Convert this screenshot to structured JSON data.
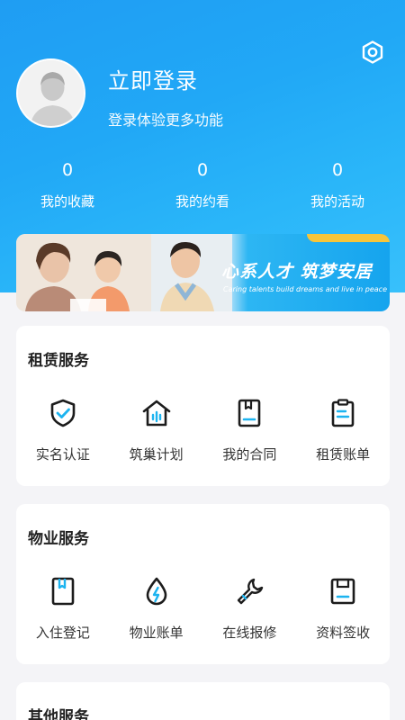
{
  "header": {
    "login_title": "立即登录",
    "login_subtitle": "登录体验更多功能",
    "settings_icon": "gear-icon"
  },
  "stats": [
    {
      "value": "0",
      "label": "我的收藏"
    },
    {
      "value": "0",
      "label": "我的约看"
    },
    {
      "value": "0",
      "label": "我的活动"
    }
  ],
  "banner": {
    "slogan": "心系人才 筑梦安居",
    "subtitle": "Caring talents build dreams and live in peace"
  },
  "sections": [
    {
      "title": "租赁服务",
      "items": [
        {
          "label": "实名认证",
          "icon": "shield-check-icon"
        },
        {
          "label": "筑巢计划",
          "icon": "house-icon"
        },
        {
          "label": "我的合同",
          "icon": "contract-book-icon"
        },
        {
          "label": "租赁账单",
          "icon": "clipboard-bill-icon"
        }
      ]
    },
    {
      "title": "物业服务",
      "items": [
        {
          "label": "入住登记",
          "icon": "bookmark-book-icon"
        },
        {
          "label": "物业账单",
          "icon": "water-drop-bolt-icon"
        },
        {
          "label": "在线报修",
          "icon": "wrench-icon"
        },
        {
          "label": "资料签收",
          "icon": "save-disk-icon"
        }
      ]
    },
    {
      "title": "其他服务",
      "items": []
    }
  ],
  "colors": {
    "primary": "#1fa0f4",
    "accent": "#1db4f0",
    "banner_stripe": "#f7c53a"
  }
}
